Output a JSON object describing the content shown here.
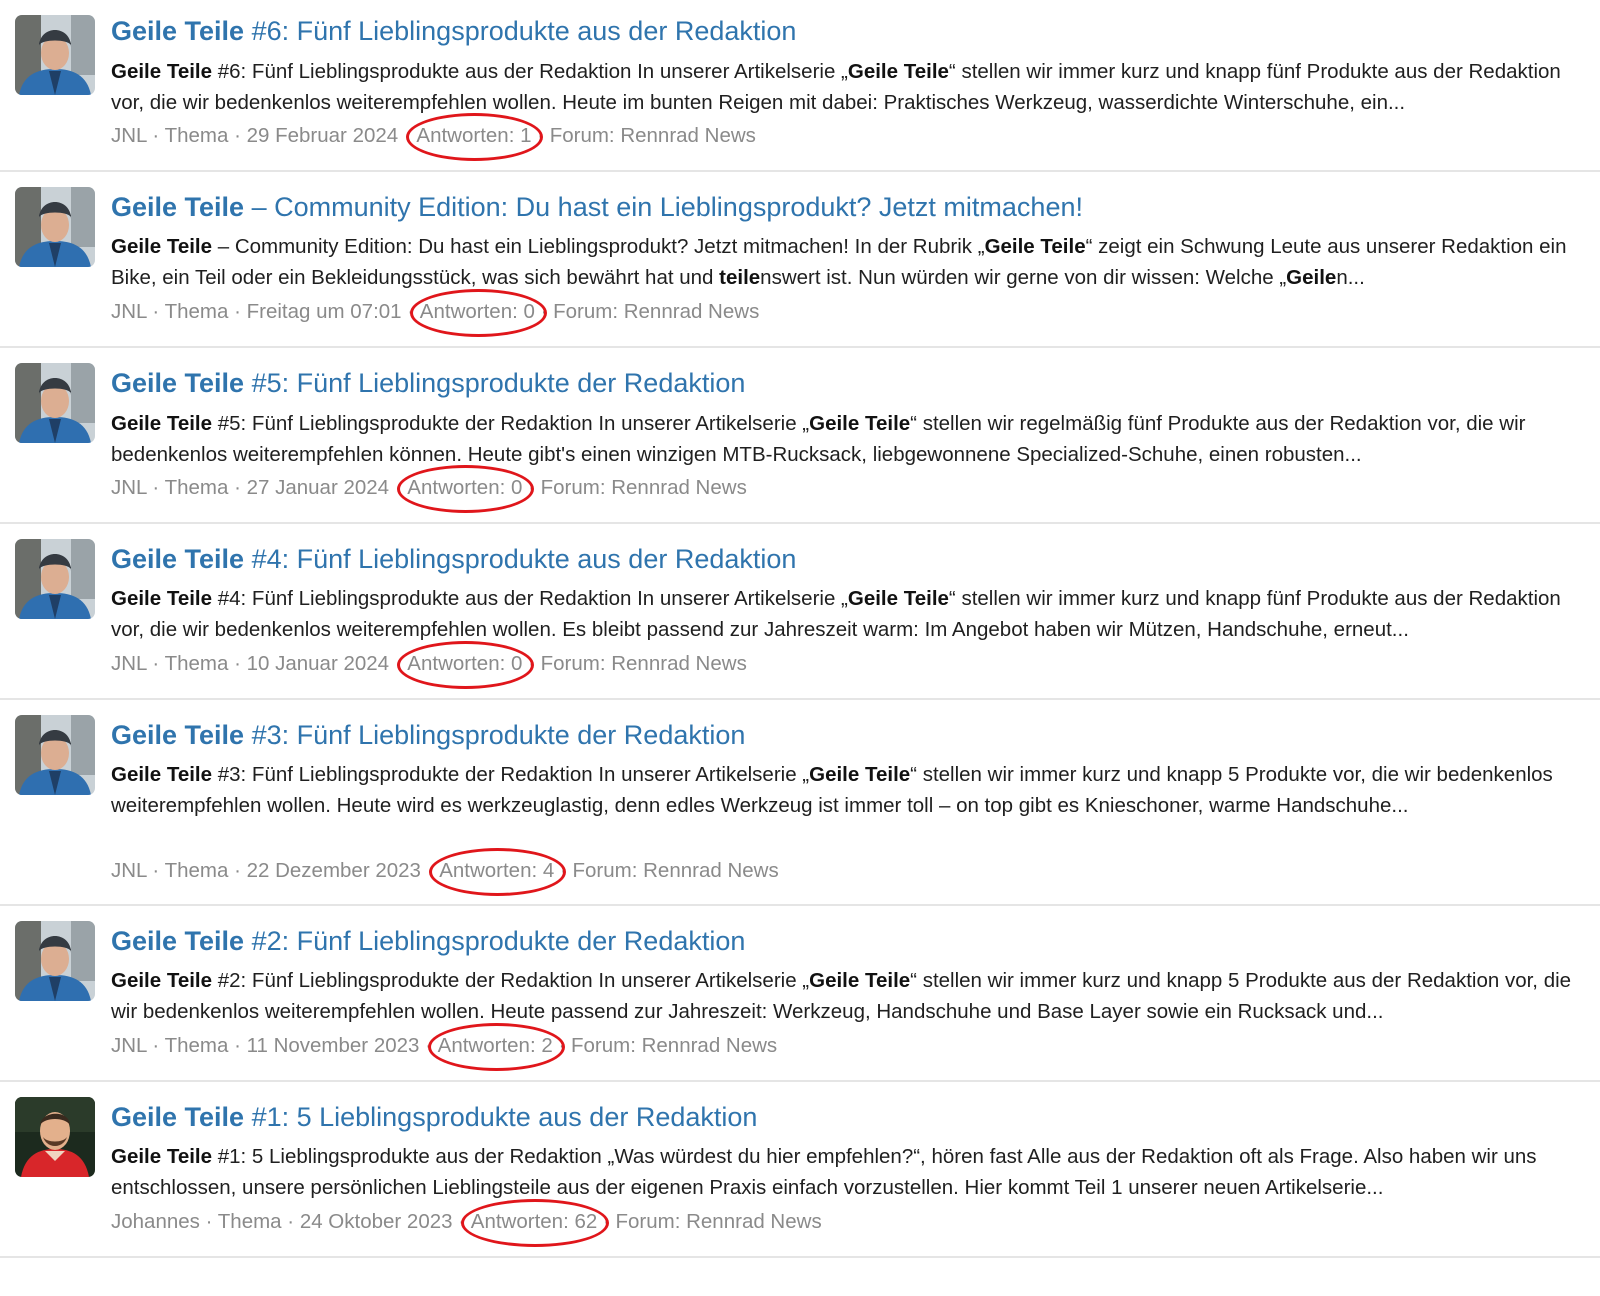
{
  "results": [
    {
      "avatar": "jnl-avatar",
      "title_bold": "Geile Teile",
      "title_rest": " #6: Fünf Lieblingsprodukte aus der Redaktion",
      "snippet": [
        {
          "b": true,
          "t": "Geile Teile"
        },
        {
          "b": false,
          "t": " #6: Fünf Lieblingsprodukte aus der Redaktion In unserer Artikelserie „"
        },
        {
          "b": true,
          "t": "Geile Teile"
        },
        {
          "b": false,
          "t": "“ stellen wir immer kurz und knapp fünf Produkte aus der Redaktion vor, die wir bedenkenlos weiterempfehlen wollen. Heute im bunten Reigen mit dabei: Praktisches Werkzeug, wasserdichte Winterschuhe, ein..."
        }
      ],
      "author": "JNL",
      "type": "Thema",
      "date": "29 Februar 2024",
      "replies": "Antworten: 1",
      "forum": "Forum: Rennrad News"
    },
    {
      "avatar": "jnl-avatar",
      "title_bold": "Geile Teile",
      "title_rest": " – Community Edition: Du hast ein Lieblingsprodukt? Jetzt mitmachen!",
      "snippet": [
        {
          "b": true,
          "t": "Geile Teile"
        },
        {
          "b": false,
          "t": " – Community Edition: Du hast ein Lieblingsprodukt? Jetzt mitmachen! In der Rubrik „"
        },
        {
          "b": true,
          "t": "Geile Teile"
        },
        {
          "b": false,
          "t": "“ zeigt ein Schwung Leute aus unserer Redaktion ein Bike, ein Teil oder ein Bekleidungsstück, was sich bewährt hat und "
        },
        {
          "b": true,
          "t": "teile"
        },
        {
          "b": false,
          "t": "nswert ist. Nun würden wir gerne von dir wissen: Welche „"
        },
        {
          "b": true,
          "t": "Geile"
        },
        {
          "b": false,
          "t": "n..."
        }
      ],
      "author": "JNL",
      "type": "Thema",
      "date": "Freitag um 07:01",
      "replies": "Antworten: 0",
      "forum": "Forum: Rennrad News"
    },
    {
      "avatar": "jnl-avatar",
      "title_bold": "Geile Teile",
      "title_rest": " #5: Fünf Lieblingsprodukte der Redaktion",
      "snippet": [
        {
          "b": true,
          "t": "Geile Teile"
        },
        {
          "b": false,
          "t": " #5: Fünf Lieblingsprodukte der Redaktion In unserer Artikelserie „"
        },
        {
          "b": true,
          "t": "Geile Teile"
        },
        {
          "b": false,
          "t": "“ stellen wir regelmäßig fünf Produkte aus der Redaktion vor, die wir bedenkenlos weiterempfehlen können. Heute gibt's einen winzigen MTB-Rucksack, liebgewonnene Specialized-Schuhe, einen robusten..."
        }
      ],
      "author": "JNL",
      "type": "Thema",
      "date": "27 Januar 2024",
      "replies": "Antworten: 0",
      "forum": "Forum: Rennrad News"
    },
    {
      "avatar": "jnl-avatar",
      "title_bold": "Geile Teile",
      "title_rest": " #4: Fünf Lieblingsprodukte aus der Redaktion",
      "snippet": [
        {
          "b": true,
          "t": "Geile Teile"
        },
        {
          "b": false,
          "t": " #4: Fünf Lieblingsprodukte aus der Redaktion In unserer Artikelserie „"
        },
        {
          "b": true,
          "t": "Geile Teile"
        },
        {
          "b": false,
          "t": "“ stellen wir immer kurz und knapp fünf Produkte aus der Redaktion vor, die wir bedenkenlos weiterempfehlen wollen. Es bleibt passend zur Jahreszeit warm: Im Angebot haben wir Mützen, Handschuhe, erneut..."
        }
      ],
      "author": "JNL",
      "type": "Thema",
      "date": "10 Januar 2024",
      "replies": "Antworten: 0",
      "forum": "Forum: Rennrad News"
    },
    {
      "avatar": "jnl-avatar",
      "title_bold": "Geile Teile",
      "title_rest": " #3: Fünf Lieblingsprodukte der Redaktion",
      "snippet": [
        {
          "b": true,
          "t": "Geile Teile"
        },
        {
          "b": false,
          "t": " #3: Fünf Lieblingsprodukte der Redaktion In unserer Artikelserie „"
        },
        {
          "b": true,
          "t": "Geile Teile"
        },
        {
          "b": false,
          "t": "“ stellen wir immer kurz und knapp 5 Produkte vor, die wir bedenkenlos weiterempfehlen wollen. Heute wird es werkzeuglastig, denn edles Werkzeug ist immer toll – on top gibt es Knieschoner, warme Handschuhe..."
        }
      ],
      "author": "JNL",
      "type": "Thema",
      "date": "22 Dezember 2023",
      "replies": "Antworten: 4",
      "forum": "Forum: Rennrad News"
    },
    {
      "avatar": "jnl-avatar",
      "title_bold": "Geile Teile",
      "title_rest": " #2: Fünf Lieblingsprodukte der Redaktion",
      "snippet": [
        {
          "b": true,
          "t": "Geile Teile"
        },
        {
          "b": false,
          "t": " #2: Fünf Lieblingsprodukte der Redaktion In unserer Artikelserie „"
        },
        {
          "b": true,
          "t": "Geile Teile"
        },
        {
          "b": false,
          "t": "“ stellen wir immer kurz und knapp 5 Produkte aus der Redaktion vor, die wir bedenkenlos weiterempfehlen wollen. Heute passend zur Jahreszeit: Werkzeug, Handschuhe und Base Layer sowie ein Rucksack und..."
        }
      ],
      "author": "JNL",
      "type": "Thema",
      "date": "11 November 2023",
      "replies": "Antworten: 2",
      "forum": "Forum: Rennrad News"
    },
    {
      "avatar": "johannes-avatar",
      "title_bold": "Geile Teile",
      "title_rest": " #1: 5 Lieblingsprodukte aus der Redaktion",
      "snippet": [
        {
          "b": true,
          "t": "Geile Teile"
        },
        {
          "b": false,
          "t": " #1: 5 Lieblingsprodukte aus der Redaktion „Was würdest du hier empfehlen?“, hören fast Alle aus der Redaktion oft als Frage. Also haben wir uns entschlossen, unsere persönlichen Lieblingsteile aus der eigenen Praxis einfach vorzustellen. Hier kommt Teil 1 unserer neuen Artikelserie..."
        }
      ],
      "author": "Johannes",
      "type": "Thema",
      "date": "24 Oktober 2023",
      "replies": "Antworten: 62",
      "forum": "Forum: Rennrad News"
    }
  ],
  "separator": " · ",
  "colors": {
    "link": "#2f74ad",
    "meta": "#8a8a8a",
    "text": "#1f1f1f",
    "highlight_ring": "#e0161b",
    "divider": "#e5e5e5"
  }
}
